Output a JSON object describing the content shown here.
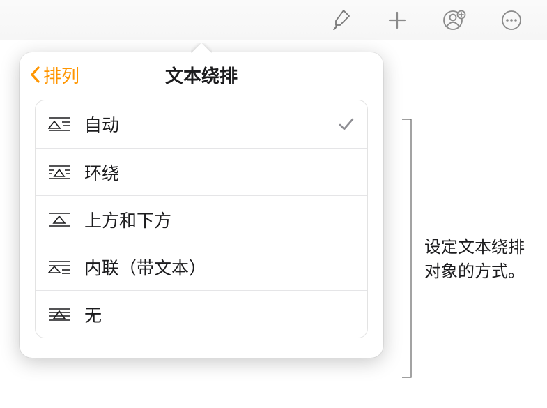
{
  "toolbar": {
    "format_icon": "format-brush-icon",
    "insert_icon": "plus-icon",
    "collaborate_icon": "person-badge-icon",
    "more_icon": "ellipsis-circle-icon"
  },
  "popover": {
    "back_label": "排列",
    "title": "文本绕排",
    "options": [
      {
        "label": "自动",
        "selected": true
      },
      {
        "label": "环绕",
        "selected": false
      },
      {
        "label": "上方和下方",
        "selected": false
      },
      {
        "label": "内联（带文本）",
        "selected": false
      },
      {
        "label": "无",
        "selected": false
      }
    ]
  },
  "annotation": {
    "line1": "设定文本绕排",
    "line2": "对象的方式。"
  }
}
